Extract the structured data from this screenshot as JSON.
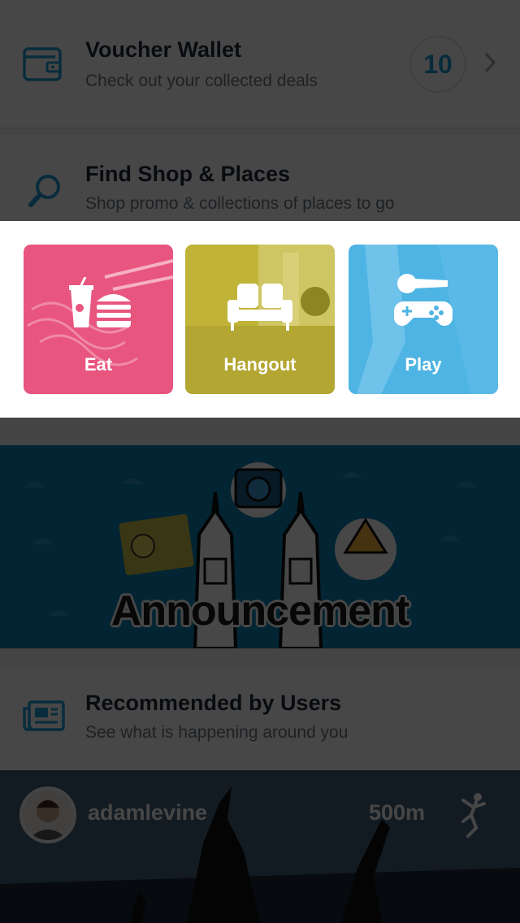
{
  "voucher": {
    "title": "Voucher Wallet",
    "subtitle": "Check out your collected deals",
    "count": "10",
    "icon": "wallet-icon"
  },
  "find": {
    "title": "Find Shop & Places",
    "subtitle": "Shop promo & collections of places to go",
    "icon": "search-icon"
  },
  "categories": [
    {
      "label": "Eat",
      "icon": "food-icon",
      "color": "#e8557e"
    },
    {
      "label": "Hangout",
      "icon": "sofa-icon",
      "color": "#c0b338"
    },
    {
      "label": "Play",
      "icon": "karaoke-gamepad-icon",
      "color": "#4eb4e3"
    }
  ],
  "announcement": {
    "label": "Announcement",
    "color": "#0d80b3"
  },
  "recommended": {
    "title": "Recommended by Users",
    "subtitle": "See what is happening around you",
    "icon": "news-icon"
  },
  "feed": {
    "username": "adamlevine",
    "distance": "500m",
    "activity_icon": "jumping-person-icon"
  },
  "colors": {
    "accent": "#1e9fd6",
    "overlay": "rgba(0,0,0,0.72)"
  }
}
